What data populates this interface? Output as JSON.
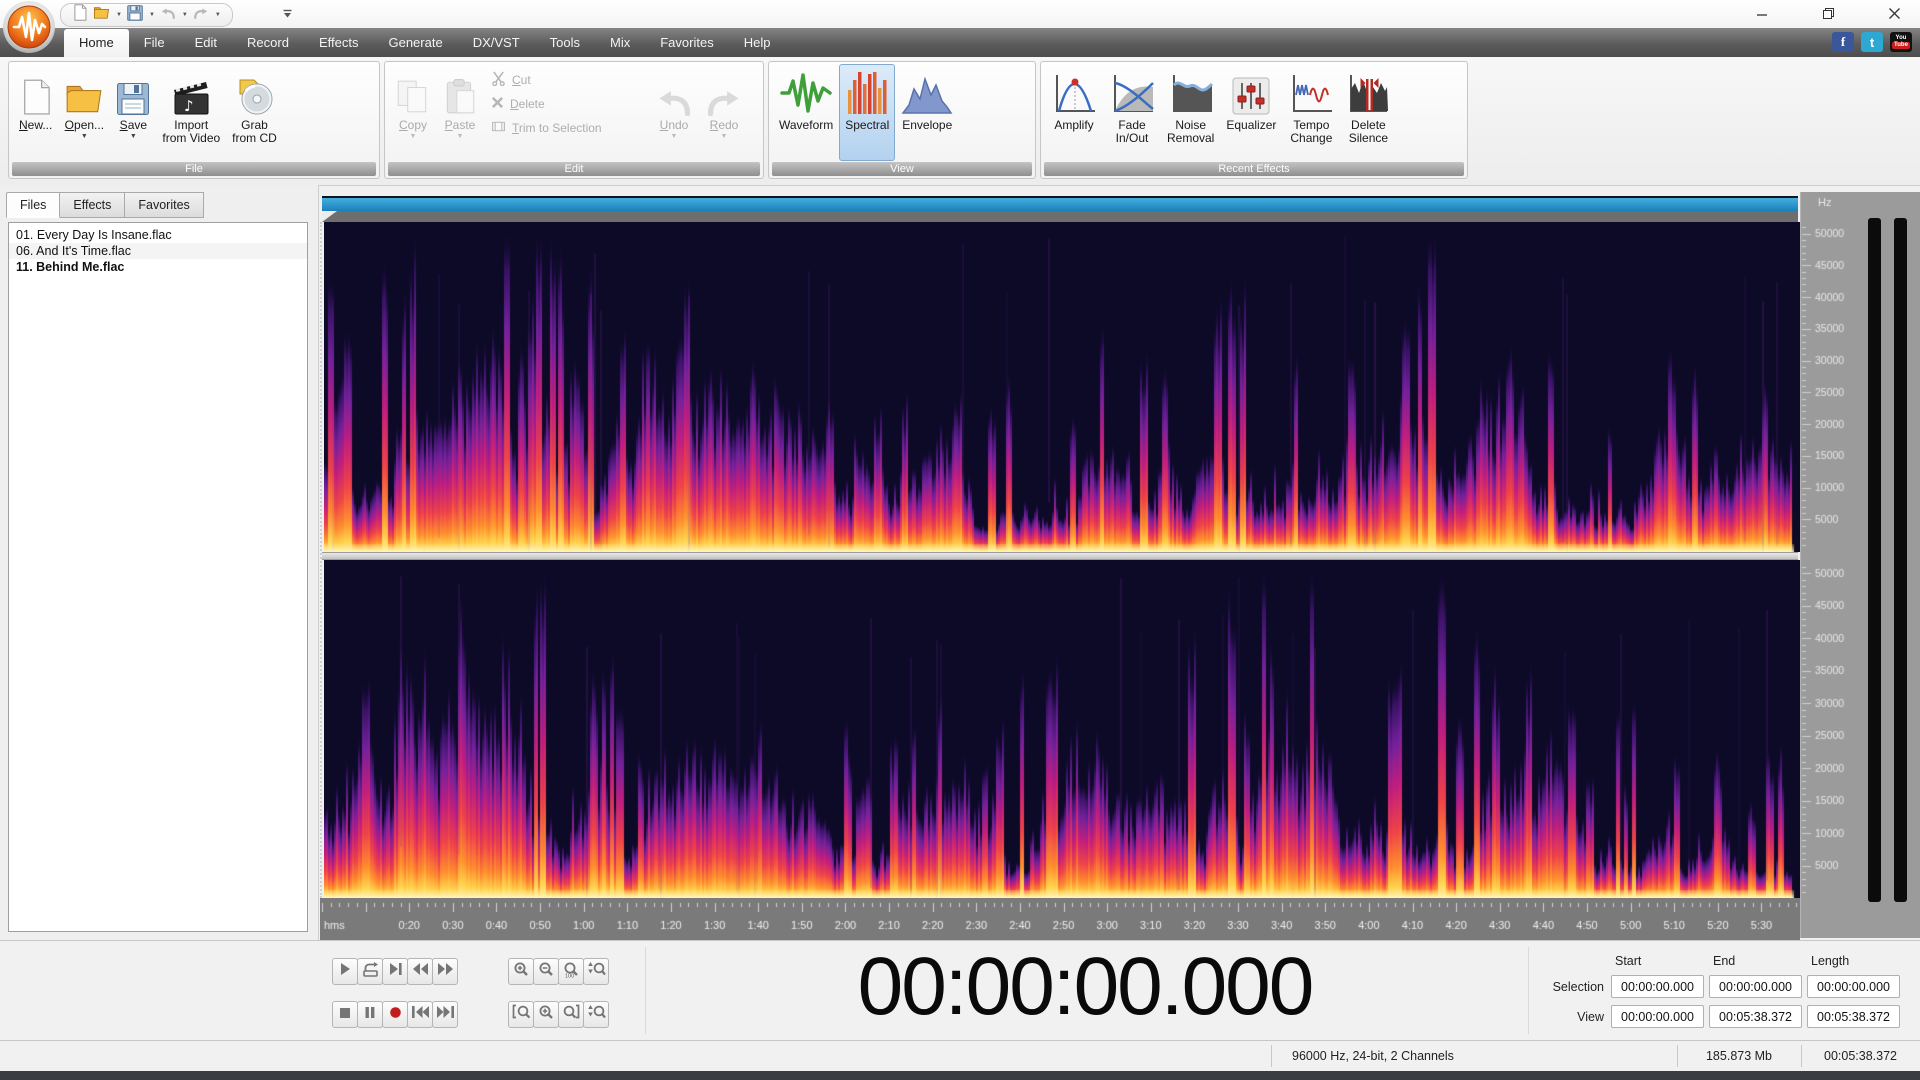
{
  "titlebar": {
    "qat": [
      {
        "name": "new-file",
        "icon": "qat-page"
      },
      {
        "name": "open-file",
        "icon": "qat-folder",
        "dropdown": true
      },
      {
        "name": "save-file",
        "icon": "qat-floppy",
        "dropdown": true
      },
      {
        "name": "undo",
        "icon": "qat-undo",
        "dropdown": true,
        "disabled": true
      },
      {
        "name": "redo",
        "icon": "qat-redo",
        "dropdown": true,
        "disabled": true
      }
    ],
    "window_controls": [
      "minimize",
      "maximize",
      "close"
    ]
  },
  "menu": {
    "tabs": [
      "Home",
      "File",
      "Edit",
      "Record",
      "Effects",
      "Generate",
      "DX/VST",
      "Tools",
      "Mix",
      "Favorites",
      "Help"
    ],
    "active_tab": "Home"
  },
  "social": [
    {
      "name": "facebook",
      "label": "f"
    },
    {
      "name": "twitter",
      "label": "t"
    },
    {
      "name": "youtube",
      "label": "You Tube"
    }
  ],
  "ribbon": {
    "groups": [
      {
        "label": "File",
        "key": "file",
        "buttons": [
          {
            "name": "new",
            "label": "New...",
            "ul": 0,
            "icon": "page"
          },
          {
            "name": "open",
            "label": "Open...",
            "ul": 0,
            "icon": "folder",
            "dropdown": true
          },
          {
            "name": "save",
            "label": "Save",
            "ul": 0,
            "icon": "floppy",
            "dropdown": true
          },
          {
            "name": "import-from-video",
            "label": [
              "Import",
              "from Video"
            ],
            "icon": "film"
          },
          {
            "name": "grab-from-cd",
            "label": [
              "Grab",
              "from CD"
            ],
            "icon": "cd"
          }
        ]
      },
      {
        "label": "Edit",
        "key": "edit",
        "buttons": [
          {
            "name": "copy",
            "label": "Copy",
            "ul": 0,
            "icon": "copy",
            "dropdown": true,
            "disabled": true
          },
          {
            "name": "paste",
            "label": "Paste",
            "ul": 0,
            "icon": "paste",
            "dropdown": true,
            "disabled": true
          },
          {
            "name": "cut",
            "label": "Cut",
            "ul": 0,
            "icon": "cut",
            "disabled": true,
            "kind": "small"
          },
          {
            "name": "delete",
            "label": "Delete",
            "ul": 0,
            "icon": "delete",
            "disabled": true,
            "kind": "small"
          },
          {
            "name": "trim-to-selection",
            "label": "Trim to Selection",
            "ul": 0,
            "icon": "trim",
            "disabled": true,
            "kind": "small"
          },
          {
            "name": "undo",
            "label": "Undo",
            "ul": 0,
            "icon": "undo",
            "dropdown": true,
            "disabled": true
          },
          {
            "name": "redo",
            "label": "Redo",
            "ul": 0,
            "icon": "redo",
            "dropdown": true,
            "disabled": true
          }
        ]
      },
      {
        "label": "View",
        "key": "view",
        "buttons": [
          {
            "name": "waveform",
            "label": "Waveform",
            "icon": "waveform"
          },
          {
            "name": "spectral",
            "label": "Spectral",
            "icon": "spectral",
            "selected": true
          },
          {
            "name": "envelope",
            "label": "Envelope",
            "icon": "envelope"
          }
        ]
      },
      {
        "label": "Recent Effects",
        "key": "recent-effects",
        "buttons": [
          {
            "name": "amplify",
            "label": "Amplify",
            "icon": "amplify"
          },
          {
            "name": "fade-in-out",
            "label": [
              "Fade",
              "In/Out"
            ],
            "icon": "fade"
          },
          {
            "name": "noise-removal",
            "label": [
              "Noise",
              "Removal"
            ],
            "icon": "noise"
          },
          {
            "name": "equalizer",
            "label": "Equalizer",
            "icon": "equalizer"
          },
          {
            "name": "tempo-change",
            "label": [
              "Tempo",
              "Change"
            ],
            "icon": "tempo"
          },
          {
            "name": "delete-silence",
            "label": [
              "Delete",
              "Silence"
            ],
            "icon": "delsilence"
          }
        ]
      }
    ]
  },
  "side_panel": {
    "tabs": [
      "Files",
      "Effects",
      "Favorites"
    ],
    "active_tab": "Files",
    "files": [
      "01. Every Day Is Insane.flac",
      "06. And It's Time.flac",
      "11. Behind Me.flac"
    ],
    "active_file": "11. Behind Me.flac"
  },
  "wave_view": {
    "freq_unit": "Hz",
    "freq_labels": [
      "50000",
      "45000",
      "40000",
      "35000",
      "30000",
      "25000",
      "20000",
      "15000",
      "10000",
      "5000"
    ],
    "ruler_unit": "hms",
    "ruler_labels": [
      "0:20",
      "0:30",
      "0:40",
      "0:50",
      "1:00",
      "1:10",
      "1:20",
      "1:30",
      "1:40",
      "1:50",
      "2:00",
      "2:10",
      "2:20",
      "2:30",
      "2:40",
      "2:50",
      "3:00",
      "3:10",
      "3:20",
      "3:30",
      "3:40",
      "3:50",
      "4:00",
      "4:10",
      "4:20",
      "4:30",
      "4:40",
      "4:50",
      "5:00",
      "5:10",
      "5:20",
      "5:30"
    ],
    "channels": 2,
    "spectrogram": {
      "bg": "#0d0a28",
      "overview_bar_color": "#2191cb",
      "palette": [
        [
          0,
          "#fff3a0"
        ],
        [
          0.05,
          "#ffd24d"
        ],
        [
          0.14,
          "#ff8f2e"
        ],
        [
          0.3,
          "#ef4348"
        ],
        [
          0.5,
          "#c21e7e"
        ],
        [
          0.7,
          "#73219b"
        ],
        [
          0.88,
          "#371263"
        ],
        [
          1,
          "rgba(20,10,48,0)"
        ]
      ]
    }
  },
  "transport": {
    "time_display": "00:00:00.000",
    "buttons_rows": [
      [
        "play",
        "loop",
        "play-to-end",
        "rewind",
        "fast-forward"
      ],
      [
        "stop",
        "pause",
        "record",
        "go-to-start",
        "go-to-end"
      ]
    ],
    "zoom_rows": [
      [
        "zoom-in",
        "zoom-out",
        "zoom-100",
        "zoom-vertical"
      ],
      [
        "zoom-selection-start",
        "zoom-in-alt",
        "zoom-selection-end",
        "zoom-vertical-alt"
      ]
    ]
  },
  "selection_view": {
    "col_headers": [
      "Start",
      "End",
      "Length"
    ],
    "rows": [
      {
        "label": "Selection",
        "values": [
          "00:00:00.000",
          "00:00:00.000",
          "00:00:00.000"
        ]
      },
      {
        "label": "View",
        "values": [
          "00:00:00.000",
          "00:05:38.372",
          "00:05:38.372"
        ]
      }
    ]
  },
  "status_bar": {
    "format": "96000 Hz, 24-bit, 2 Channels",
    "file_size": "185.873 Mb",
    "duration": "00:05:38.372"
  }
}
